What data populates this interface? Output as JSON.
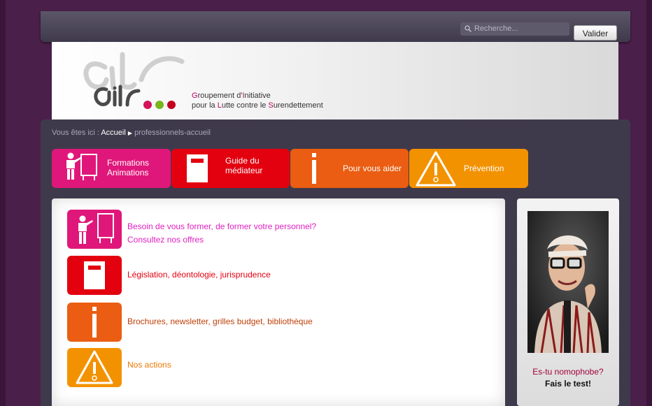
{
  "header": {
    "search_placeholder": "Recherche...",
    "submit_label": "Valider"
  },
  "banner": {
    "logo_text": "gils",
    "org_line1_initial": "G",
    "org_line1_rest": "roupement d'",
    "org_line1_initial2": "I",
    "org_line1_rest2": "nitiative",
    "org_line2_a": "pour la ",
    "org_line2_b": "L",
    "org_line2_c": "utte contre le ",
    "org_line2_d": "S",
    "org_line2_e": "urendettement"
  },
  "breadcrumb": {
    "prefix": "Vous êtes ici :",
    "home": "Accueil",
    "current": "professionnels-accueil"
  },
  "tabs": [
    {
      "line1": "Formations",
      "line2": "Animations",
      "color": "#e0177a",
      "icon": "trainer-icon"
    },
    {
      "line1": "Guide du",
      "line2": "médiateur",
      "color": "#e3000f",
      "icon": "book-icon"
    },
    {
      "line1": "Pour vous aider",
      "line2": "",
      "color": "#ea5d12",
      "icon": "info-icon"
    },
    {
      "line1": "Prévention",
      "line2": "",
      "color": "#f39200",
      "icon": "warning-icon"
    }
  ],
  "items": [
    {
      "line1": "Besoin de vous former, de former votre personnel?",
      "line2": "Consultez nos offres",
      "color": "#e0177a",
      "text_color": "#e020c0"
    },
    {
      "line1": "Législation, déontologie, jurisprudence",
      "line2": "",
      "color": "#e3000f",
      "text_color": "#e3000f"
    },
    {
      "line1": "Brochures, newsletter, grilles budget, bibliothèque",
      "line2": "",
      "color": "#ea5d12",
      "text_color": "#c0400a"
    },
    {
      "line1": "Nos actions",
      "line2": "",
      "color": "#f39200",
      "text_color": "#f07800"
    }
  ],
  "sidebar": {
    "promo_line1": "Es-tu nomophobe?",
    "promo_line2": "Fais le test!"
  }
}
